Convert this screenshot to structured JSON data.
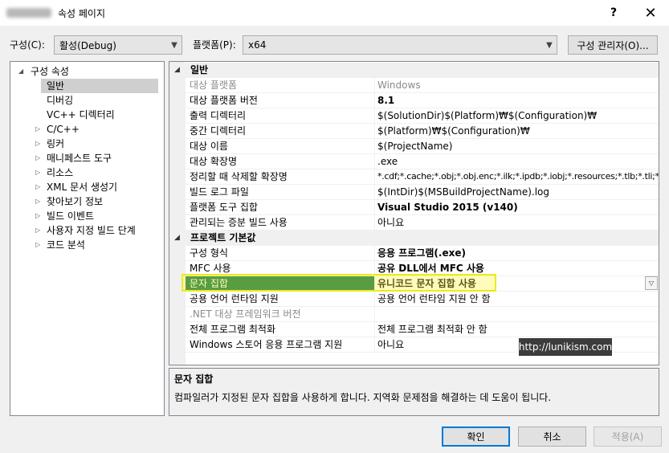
{
  "window": {
    "title": "속성 페이지",
    "help_glyph": "?",
    "close_glyph": "✕"
  },
  "toolbar": {
    "config_label": "구성(C):",
    "config_value": "활성(Debug)",
    "platform_label": "플랫폼(P):",
    "platform_value": "x64",
    "manager_button": "구성 관리자(O)..."
  },
  "tree": {
    "root": "구성 속성",
    "items": [
      {
        "label": "일반",
        "expandable": false,
        "selected": true
      },
      {
        "label": "디버깅",
        "expandable": false
      },
      {
        "label": "VC++ 디렉터리",
        "expandable": false
      },
      {
        "label": "C/C++",
        "expandable": true
      },
      {
        "label": "링커",
        "expandable": true
      },
      {
        "label": "매니페스트 도구",
        "expandable": true
      },
      {
        "label": "리소스",
        "expandable": true
      },
      {
        "label": "XML 문서 생성기",
        "expandable": true
      },
      {
        "label": "찾아보기 정보",
        "expandable": true
      },
      {
        "label": "빌드 이벤트",
        "expandable": true
      },
      {
        "label": "사용자 지정 빌드 단계",
        "expandable": true
      },
      {
        "label": "코드 분석",
        "expandable": true
      }
    ]
  },
  "grid": {
    "category_general": "일반",
    "general_rows": [
      {
        "name": "대상 플랫폼",
        "value": "Windows",
        "disabled": true
      },
      {
        "name": "대상 플랫폼 버전",
        "value": "8.1",
        "bold": true
      },
      {
        "name": "출력 디렉터리",
        "value": "$(SolutionDir)$(Platform)₩$(Configuration)₩"
      },
      {
        "name": "중간 디렉터리",
        "value": "$(Platform)₩$(Configuration)₩"
      },
      {
        "name": "대상 이름",
        "value": "$(ProjectName)"
      },
      {
        "name": "대상 확장명",
        "value": ".exe"
      },
      {
        "name": "정리할 때 삭제할 확장명",
        "value": "*.cdf;*.cache;*.obj;*.obj.enc;*.ilk;*.ipdb;*.iobj;*.resources;*.tlb;*.tli;*."
      },
      {
        "name": "빌드 로그 파일",
        "value": "$(IntDir)$(MSBuildProjectName).log"
      },
      {
        "name": "플랫폼 도구 집합",
        "value": "Visual Studio 2015 (v140)",
        "bold": true
      },
      {
        "name": "관리되는 증분 빌드 사용",
        "value": "아니요"
      }
    ],
    "category_defaults": "프로젝트 기본값",
    "default_rows": [
      {
        "name": "구성 형식",
        "value": "응용 프로그램(.exe)",
        "bold": true
      },
      {
        "name": "MFC 사용",
        "value": "공유 DLL에서 MFC 사용",
        "bold": true
      },
      {
        "name": "문자 집합",
        "value": "유니코드 문자 집합 사용",
        "selected": true
      },
      {
        "name": "공용 언어 런타임 지원",
        "value": "공용 언어 런타임 지원 안 함"
      },
      {
        "name": ".NET 대상 프레임워크 버전",
        "value": "",
        "disabled": true
      },
      {
        "name": "전체 프로그램 최적화",
        "value": "전체 프로그램 최적화 안 함"
      },
      {
        "name": "Windows 스토어 응용 프로그램 지원",
        "value": "아니요"
      }
    ]
  },
  "watermark": "http://lunikism.com",
  "description": {
    "title": "문자 집합",
    "text": "컴파일러가 지정된 문자 집합을 사용하게 합니다. 지역화 문제점을 해결하는 데 도움이 됩니다."
  },
  "footer": {
    "ok": "확인",
    "cancel": "취소",
    "apply": "적용(A)"
  }
}
